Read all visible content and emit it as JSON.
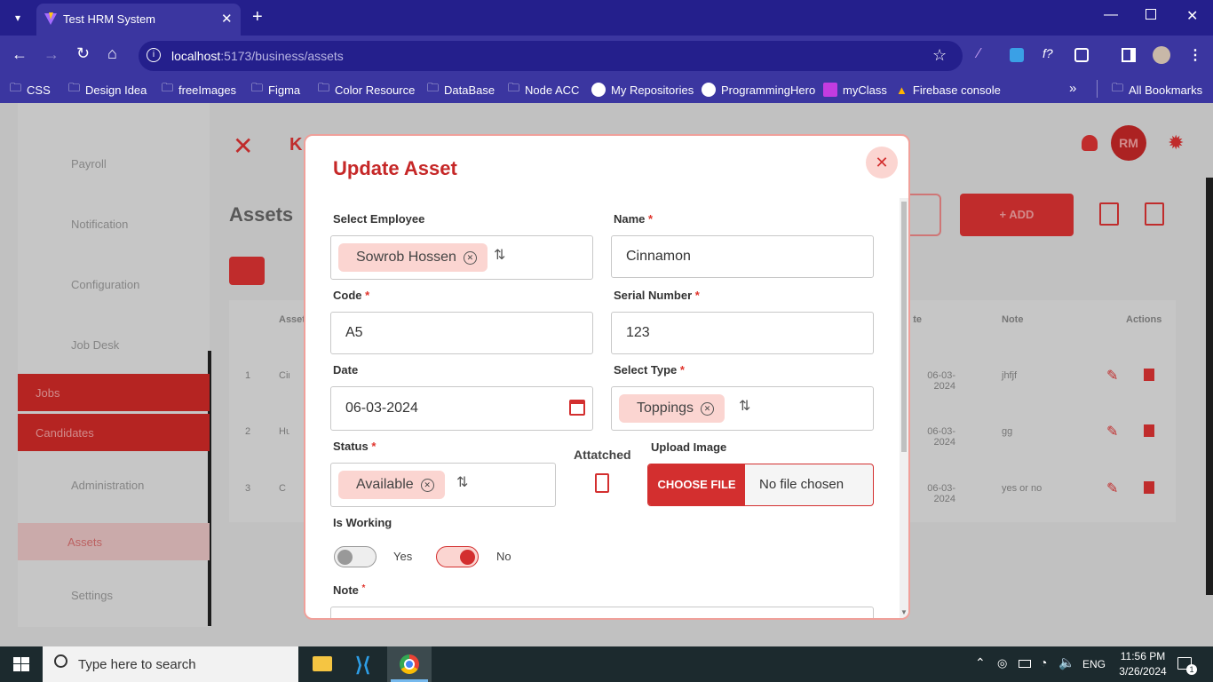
{
  "browser": {
    "tab_title": "Test HRM System",
    "url_host": "localhost",
    "url_path": ":5173/business/assets",
    "bookmarks": [
      "CSS",
      "Design Idea",
      "freeImages",
      "Figma",
      "Color Resource",
      "DataBase",
      "Node ACC",
      "My Repositories",
      "ProgrammingHero",
      "myClass",
      "Firebase console"
    ],
    "all_bookmarks": "All Bookmarks"
  },
  "app": {
    "page_title": "Assets",
    "header_logo": "K",
    "avatar_initials": "RM",
    "add_label": "+ ADD",
    "sidebar": [
      "Payroll",
      "Notification",
      "Configuration",
      "Job Desk",
      "Jobs",
      "Candidates",
      "Administration",
      "Assets",
      "Settings"
    ],
    "table": {
      "headers": [
        "Asset",
        "Date",
        "Note",
        "Actions"
      ],
      "rows": [
        {
          "n": "1",
          "asset": "Cinn",
          "date": "06-03-2024",
          "note": "jhfjf"
        },
        {
          "n": "2",
          "asset": "Hum",
          "date": "06-03-2024",
          "note": "gg"
        },
        {
          "n": "3",
          "asset": "C",
          "date": "06-03-2024",
          "note": "yes or no"
        }
      ]
    }
  },
  "modal": {
    "title": "Update Asset",
    "employee": {
      "label": "Select Employee",
      "value": "Sowrob Hossen"
    },
    "name": {
      "label": "Name",
      "value": "Cinnamon"
    },
    "code": {
      "label": "Code",
      "value": "A5"
    },
    "serial": {
      "label": "Serial Number",
      "value": "123"
    },
    "date": {
      "label": "Date",
      "value": "06-03-2024"
    },
    "type": {
      "label": "Select Type",
      "value": "Toppings"
    },
    "status": {
      "label": "Status",
      "value": "Available"
    },
    "attached_label": "Attatched",
    "upload": {
      "label": "Upload Image",
      "button": "CHOOSE FILE",
      "status": "No file chosen"
    },
    "is_working": {
      "label": "Is Working",
      "yes": "Yes",
      "no": "No",
      "selected": "No"
    },
    "note": {
      "label": "Note"
    },
    "required_mark": "*"
  },
  "taskbar": {
    "search_placeholder": "Type here to search",
    "lang": "ENG",
    "time": "11:56 PM",
    "date": "3/26/2024",
    "notif_count": "1"
  },
  "colors": {
    "accent": "#d32f2f",
    "chip": "#fbd5d1",
    "browser_dark": "#241f8c",
    "browser": "#3b36a0"
  }
}
